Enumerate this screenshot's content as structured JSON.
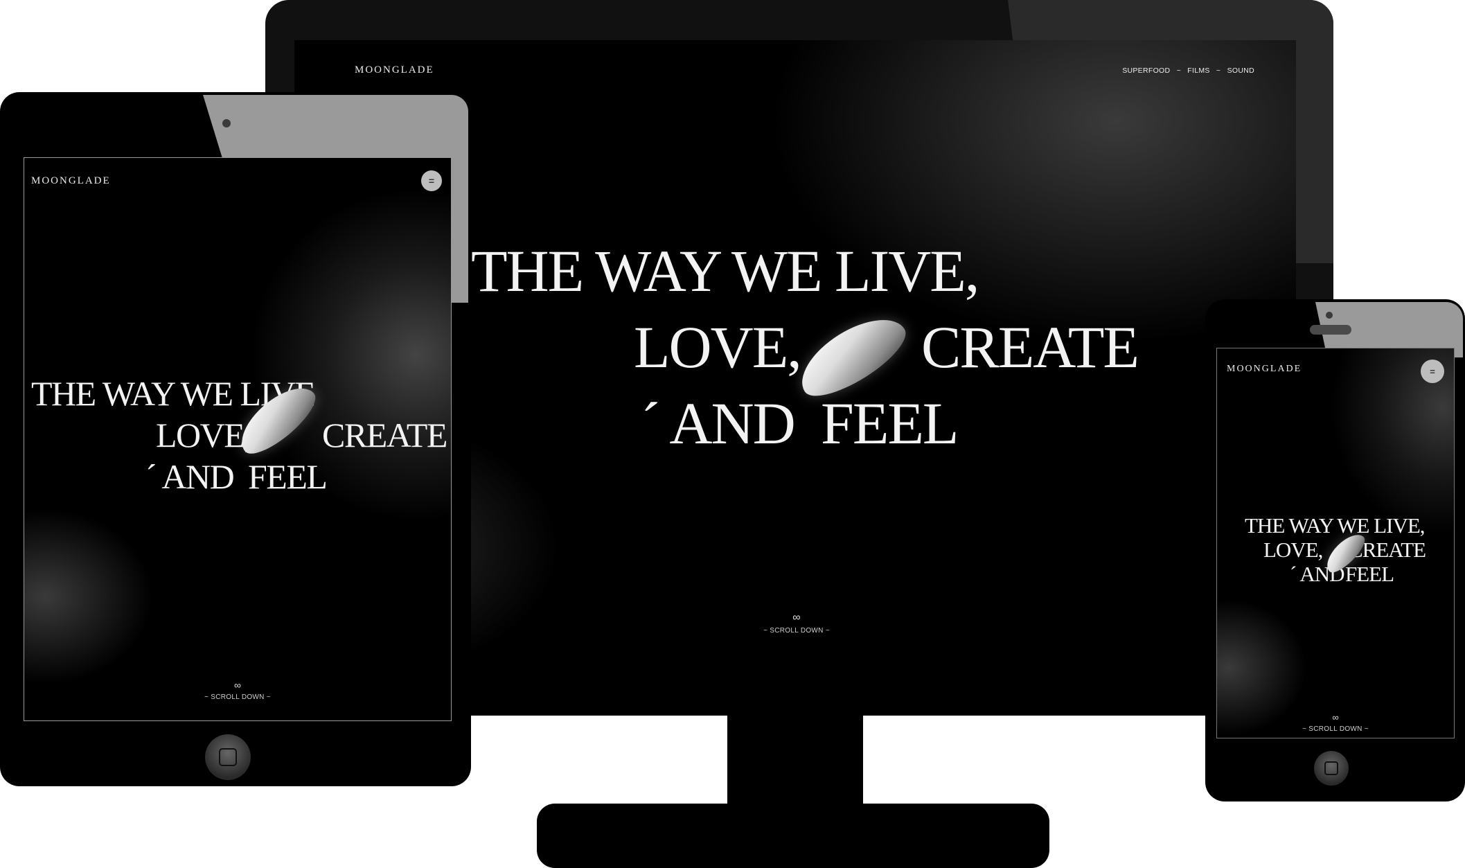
{
  "brand": {
    "logo": "MOONGLADE"
  },
  "desktop": {
    "nav": [
      "SUPERFOOD",
      "FILMS",
      "SOUND"
    ],
    "nav_separator": "~",
    "headline": {
      "line1": "THE WAY WE LIVE,",
      "line2a": "LOVE,",
      "line2b": "CREATE",
      "line3a": "´ AND ",
      "line3b": "FEEL"
    },
    "infinity": "∞",
    "scroll": "~ SCROLL DOWN ~"
  },
  "tablet": {
    "headline": {
      "line1": "THE WAY WE LIVE",
      "line2a": "LOVE,",
      "line2b": "CREATE",
      "line3a": "´ AND ",
      "line3b": "FEEL"
    },
    "menu": "=",
    "infinity": "∞",
    "scroll": "~ SCROLL DOWN ~"
  },
  "phone": {
    "headline": {
      "line1": "THE WAY WE LIVE,",
      "line2a": "LOVE,",
      "line2b": "CREATE",
      "line3a": "´ AND ",
      "line3b": "FEEL"
    },
    "menu": "=",
    "infinity": "∞",
    "scroll": "~ SCROLL DOWN ~"
  },
  "colors": {
    "background": "#ffffff",
    "device": "#000000",
    "text": "#f3f3f3",
    "accent_gray": "#a9a9a9"
  }
}
